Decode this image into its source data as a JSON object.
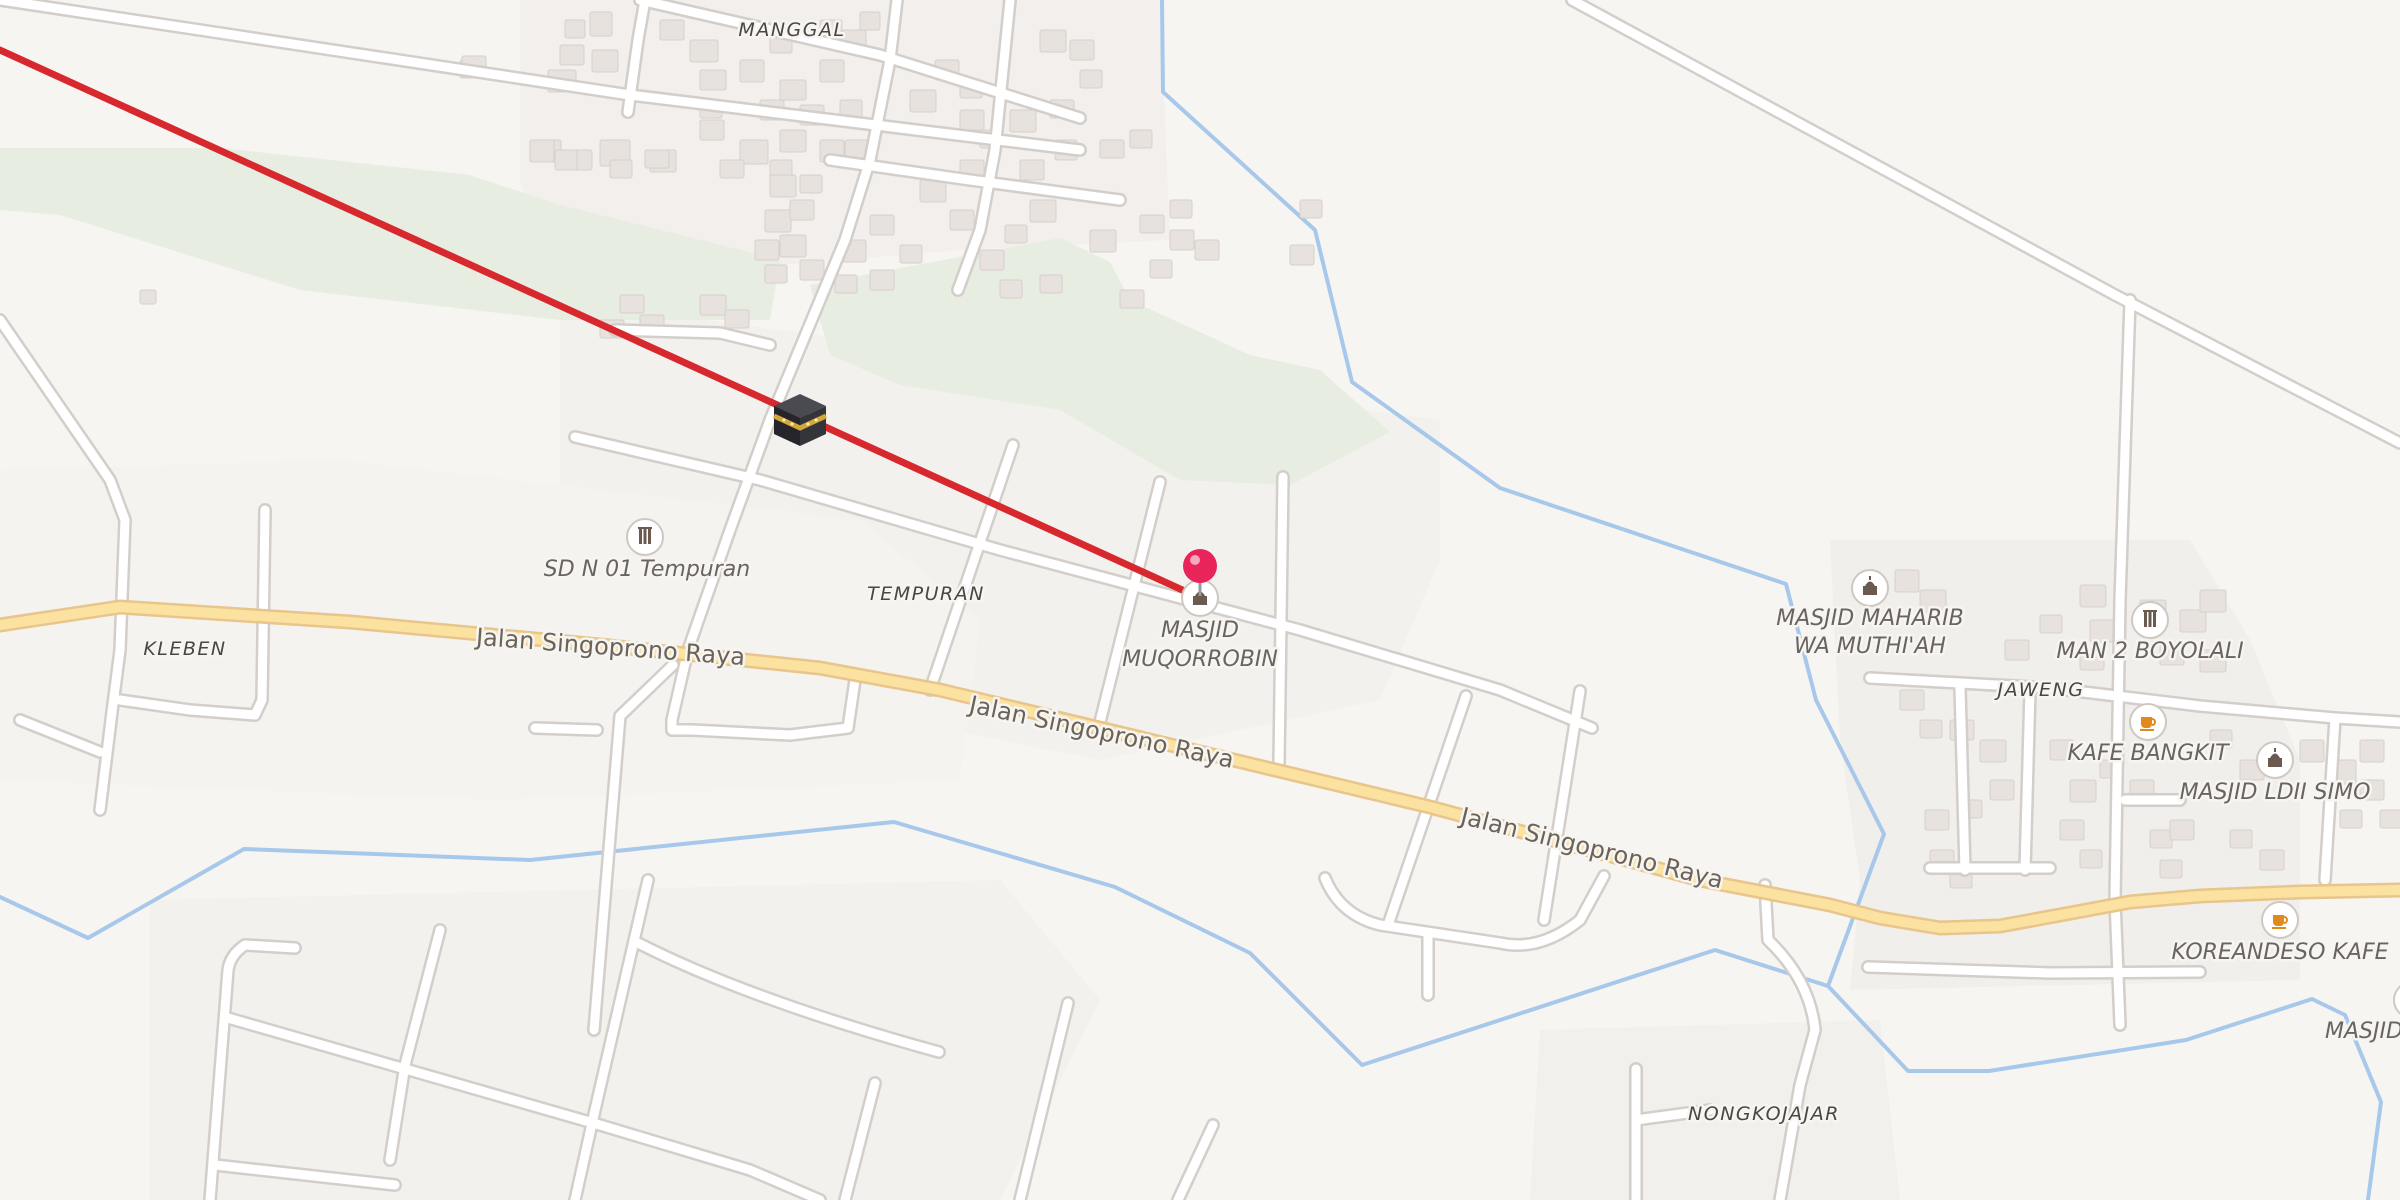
{
  "map": {
    "places": {
      "manggal": "MANGGAL",
      "tempuran": "TEMPURAN",
      "kleben": "KLEBEN",
      "jaweng": "JAWENG",
      "nongkojajar": "NONGKOJAJAR"
    },
    "streets": {
      "s1": "Jalan Singoprono Raya",
      "s2": "Jalan Singoprono Raya",
      "s3": "Jalan Singoprono Raya"
    },
    "pois": {
      "sd": "SD N 01 Tempuran",
      "mm1": "MASJID",
      "mm2": "MUQORROBIN",
      "mh1": "MASJID MAHARIB",
      "mh2": "WA MUTHI'AH",
      "man2": "MAN 2 BOYOLALI",
      "kafe": "KAFE BANGKIT",
      "ldii": "MASJID LDII SIMO",
      "korean": "KOREANDESO KAFE",
      "masjidEdge": "MASJID"
    },
    "icons": {
      "school": "school-icon",
      "mosque": "mosque-icon",
      "cafe": "cafe-icon",
      "kaaba": "kaaba-icon",
      "pin": "location-pin-icon"
    },
    "colors": {
      "background": "#f7f5f2",
      "road": "#ffffff",
      "mainRoad": "#fbe2a0",
      "water": "#a7c8ea",
      "green": "#e7ede1",
      "qiblaLine": "#d7282e",
      "pin": "#e8245a"
    }
  }
}
